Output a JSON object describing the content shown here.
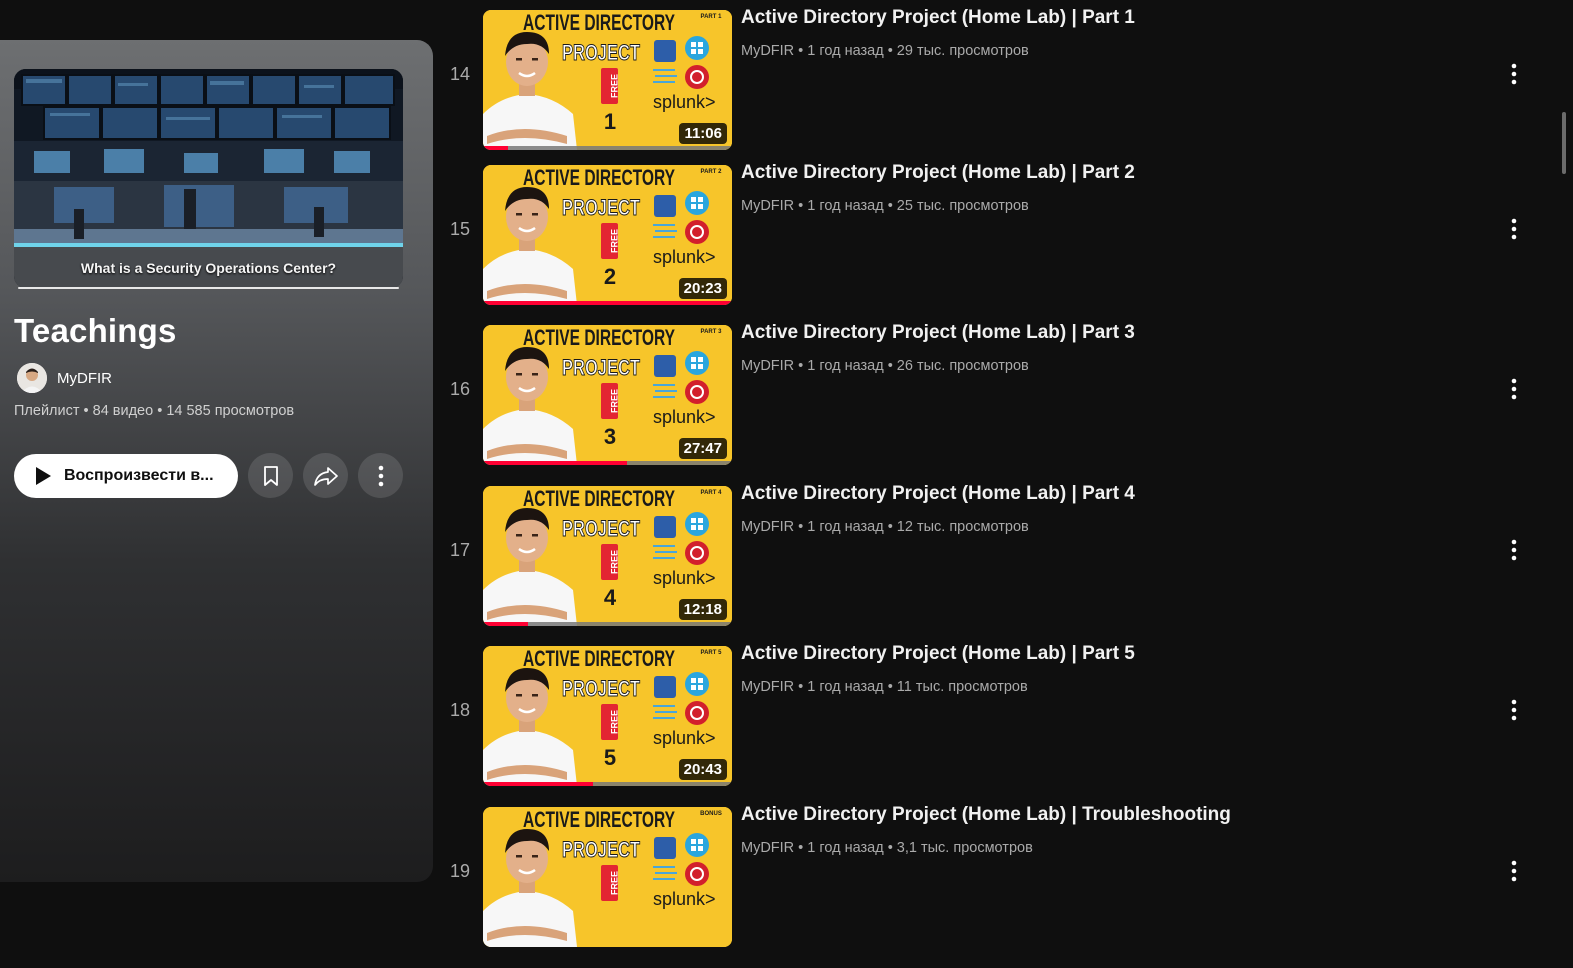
{
  "playlist": {
    "cover_caption": "What is a Security Operations Center?",
    "title": "Teachings",
    "owner": "MyDFIR",
    "meta": "Плейлист • 84 видео • 14 585 просмотров",
    "play_label": "Воспроизвести в...",
    "icons": {
      "play": "play-icon",
      "save": "bookmark-icon",
      "share": "share-icon",
      "more": "more-vert-icon"
    }
  },
  "thumbnail": {
    "headline": "ACTIVE DIRECTORY",
    "sub": "PROJECT",
    "tag": "FREE",
    "brand": "splunk>",
    "colors": {
      "background": "#f7c52a",
      "progress": "#ff0033"
    }
  },
  "videos": [
    {
      "index": "14",
      "title": "Active Directory Project (Home Lab) | Part 1",
      "meta": "MyDFIR • 1 год назад • 29 тыс. просмотров",
      "duration": "11:06",
      "part_badge": "PART 1",
      "number": "1",
      "progress": 0.1
    },
    {
      "index": "15",
      "title": "Active Directory Project (Home Lab) | Part 2",
      "meta": "MyDFIR • 1 год назад • 25 тыс. просмотров",
      "duration": "20:23",
      "part_badge": "PART 2",
      "number": "2",
      "progress": 1.0
    },
    {
      "index": "16",
      "title": "Active Directory Project (Home Lab) | Part 3",
      "meta": "MyDFIR • 1 год назад • 26 тыс. просмотров",
      "duration": "27:47",
      "part_badge": "PART 3",
      "number": "3",
      "progress": 0.58
    },
    {
      "index": "17",
      "title": "Active Directory Project (Home Lab) | Part 4",
      "meta": "MyDFIR • 1 год назад • 12 тыс. просмотров",
      "duration": "12:18",
      "part_badge": "PART 4",
      "number": "4",
      "progress": 0.18
    },
    {
      "index": "18",
      "title": "Active Directory Project (Home Lab) | Part 5",
      "meta": "MyDFIR • 1 год назад • 11 тыс. просмотров",
      "duration": "20:43",
      "part_badge": "PART 5",
      "number": "5",
      "progress": 0.44
    },
    {
      "index": "19",
      "title": "Active Directory Project (Home Lab) | Troubleshooting",
      "meta": "MyDFIR • 1 год назад • 3,1 тыс. просмотров",
      "duration": "",
      "part_badge": "BONUS",
      "number": "",
      "progress": 0
    }
  ]
}
